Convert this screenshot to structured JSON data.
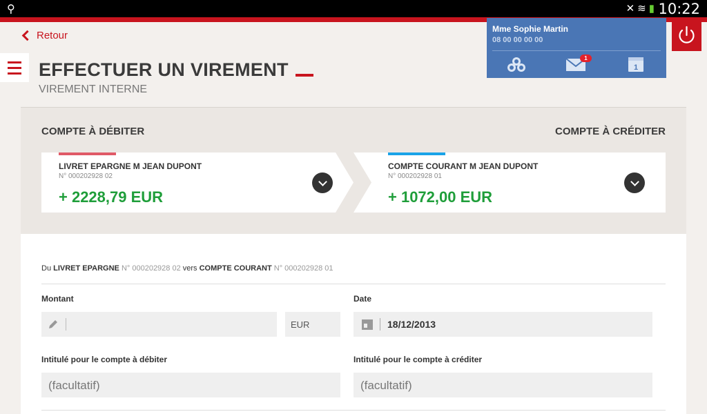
{
  "status_bar": {
    "time": "10:22"
  },
  "nav": {
    "back_label": "Retour"
  },
  "header": {
    "title": "EFFECTUER UN VIREMENT",
    "subtitle": "VIREMENT INTERNE"
  },
  "user": {
    "name": "Mme Sophie Martin",
    "phone": "08 00 00 00 00",
    "messages_badge": "1",
    "calendar_day": "1"
  },
  "accounts": {
    "debit_heading": "COMPTE À DÉBITER",
    "credit_heading": "COMPTE À CRÉDITER",
    "debit": {
      "name": "LIVRET EPARGNE M JEAN DUPONT",
      "number": "N° 000202928 02",
      "balance": "+ 2228,79 EUR",
      "accent_color": "#e05a67"
    },
    "credit": {
      "name": "COMPTE COURANT M JEAN DUPONT",
      "number": "N° 000202928 01",
      "balance": "+ 1072,00 EUR",
      "accent_color": "#1aa3e8"
    }
  },
  "form": {
    "summary": {
      "from_prefix": "Du",
      "from_label": "LIVRET EPARGNE",
      "from_number": "N° 000202928 02",
      "to_prefix": "vers",
      "to_label": "COMPTE COURANT",
      "to_number": "N° 000202928 01"
    },
    "amount_label": "Montant",
    "amount_value": "",
    "currency": "EUR",
    "date_label": "Date",
    "date_value": "18/12/2013",
    "debit_wording_label": "Intitulé pour le compte à débiter",
    "debit_wording_placeholder": "(facultatif)",
    "credit_wording_label": "Intitulé pour le compte à créditer",
    "credit_wording_placeholder": "(facultatif)"
  },
  "colors": {
    "brand_red": "#c8141e",
    "user_panel_blue": "#4a76b5",
    "balance_green": "#1f9e3a"
  }
}
